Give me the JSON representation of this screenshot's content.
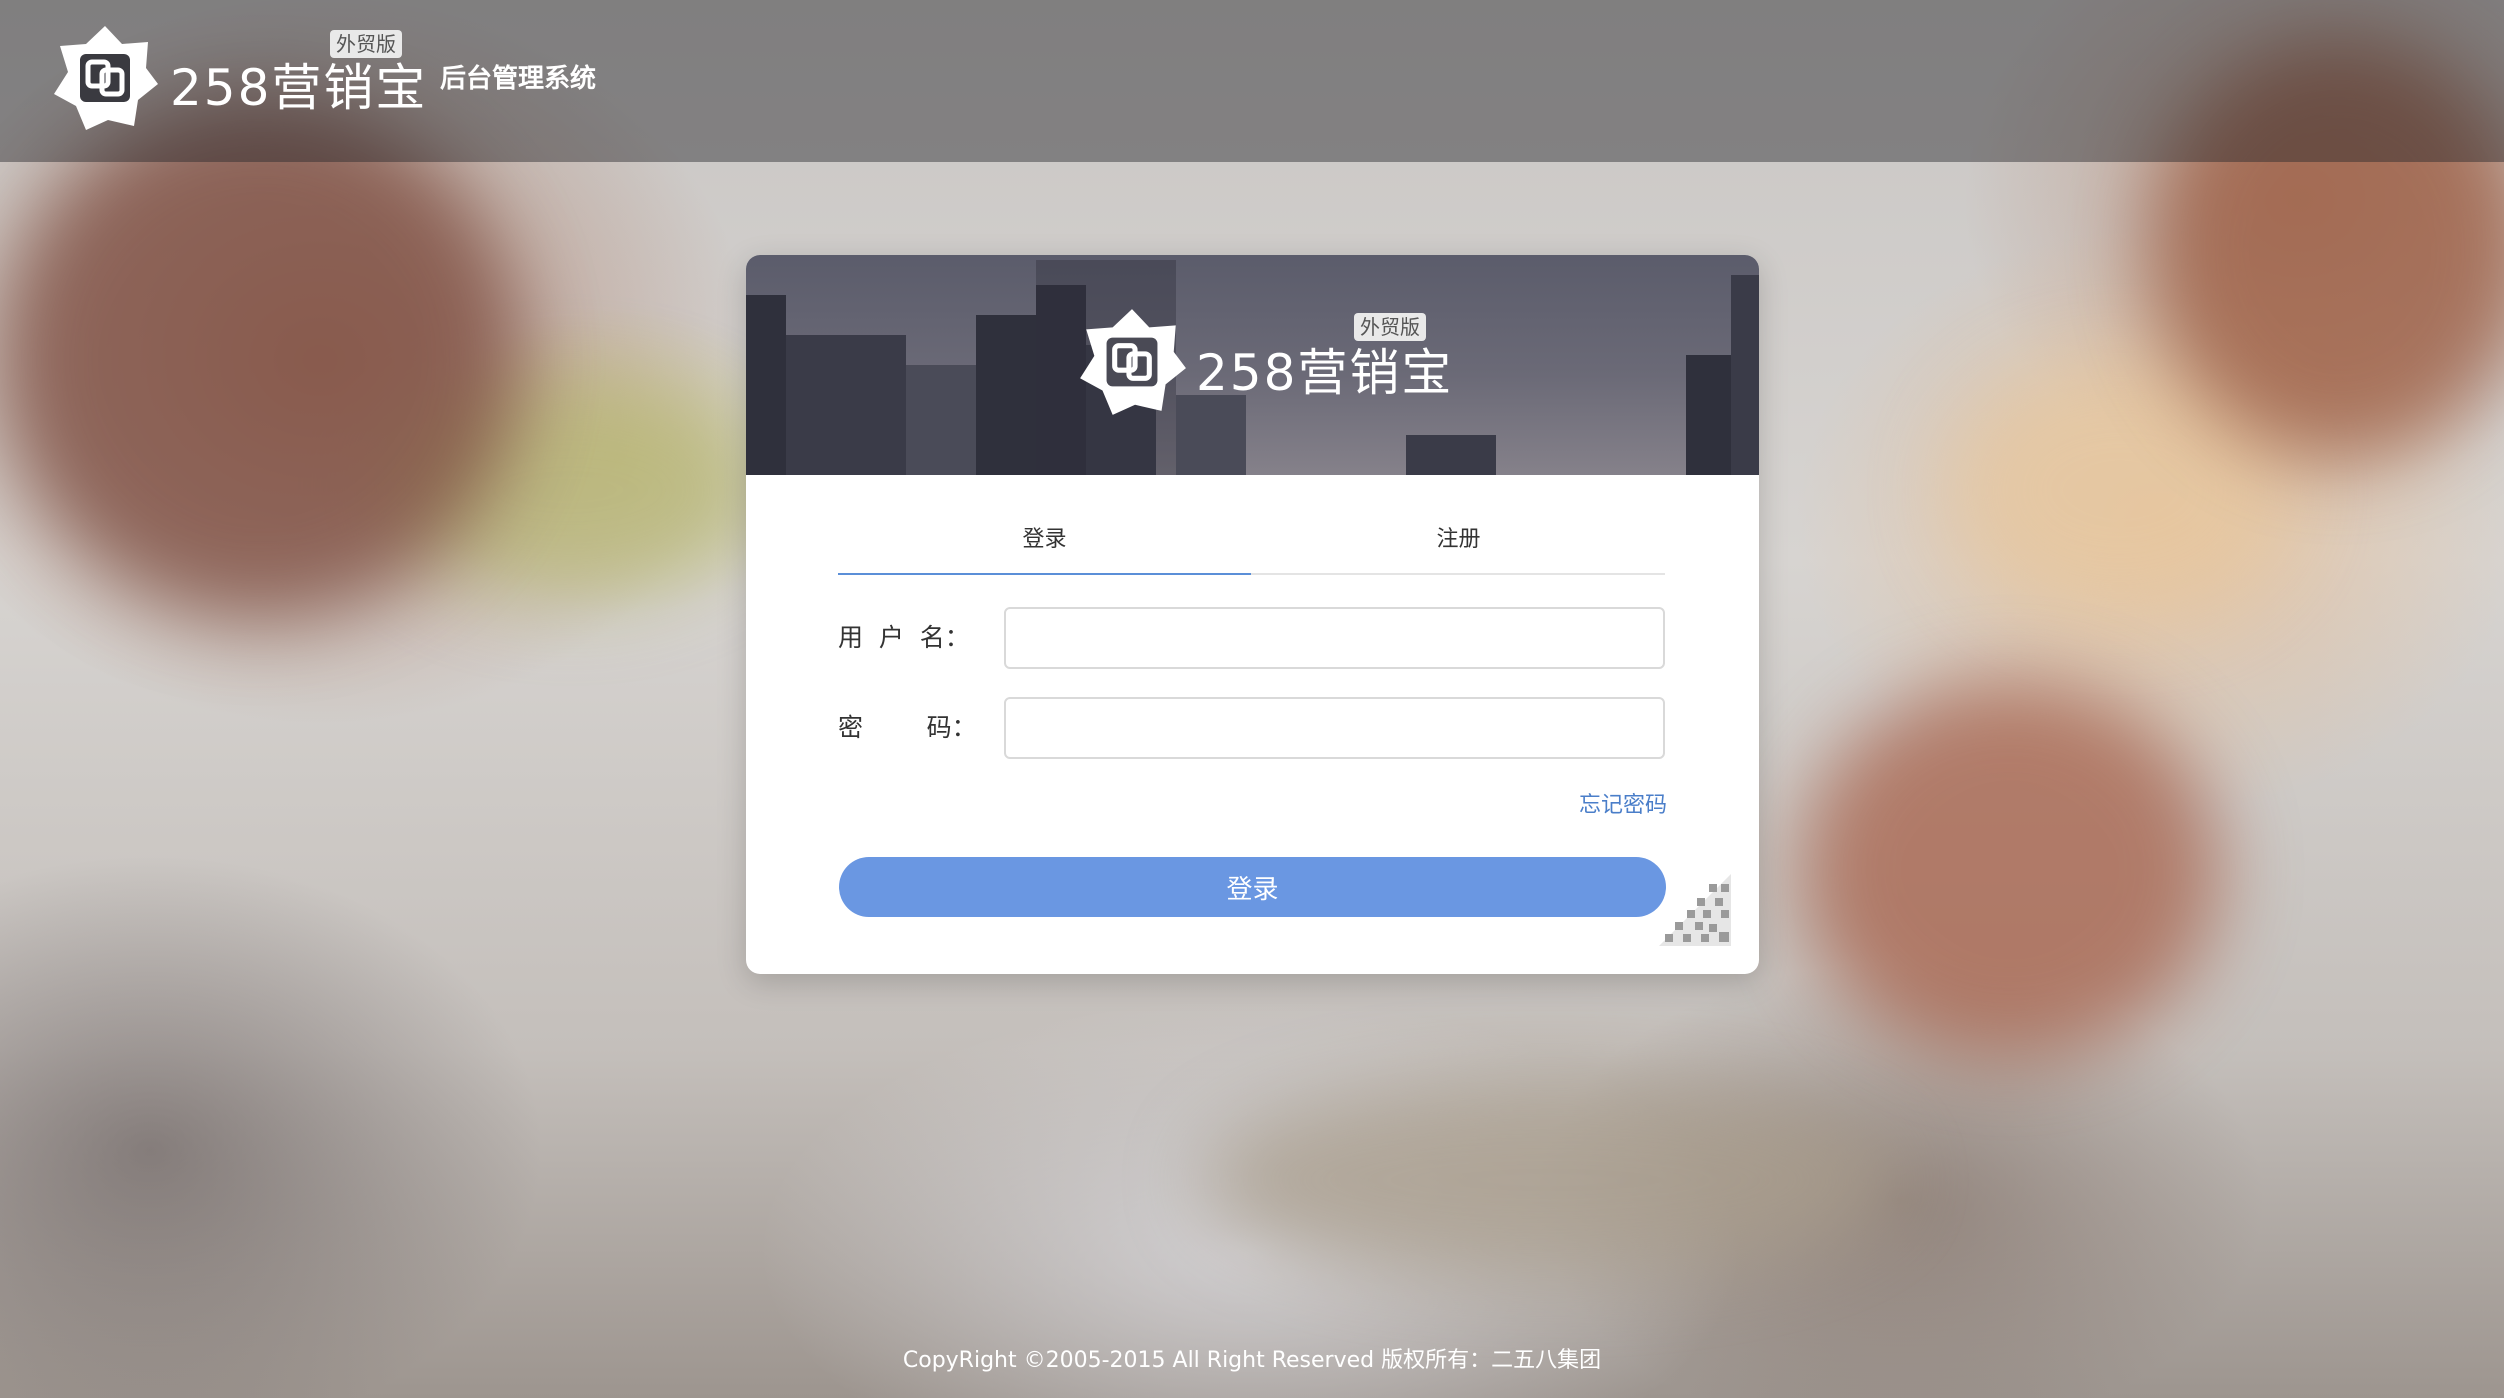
{
  "header": {
    "brand_name": "258营销宝",
    "brand_badge": "外贸版",
    "system_title": "后台管理系统"
  },
  "login_card": {
    "banner": {
      "brand_name": "258营销宝",
      "brand_badge": "外贸版"
    },
    "tabs": [
      {
        "label": "登录",
        "active": true
      },
      {
        "label": "注册",
        "active": false
      }
    ],
    "fields": {
      "username": {
        "label": "用  户  名：",
        "value": "",
        "placeholder": ""
      },
      "password": {
        "label": "密        码：",
        "value": "",
        "placeholder": ""
      }
    },
    "forgot_password_label": "忘记密码",
    "submit_label": "登录"
  },
  "footer": {
    "copyright": "CopyRight ©2005-2015 All Right Reserved 版权所有：二五八集团"
  },
  "colors": {
    "accent": "#6a97e2",
    "link": "#4a7ec9",
    "tab_active_underline": "#5b8fd8"
  },
  "icons": {
    "brand_logo": "258-logo-icon",
    "qr_toggle": "qr-code-corner-icon"
  }
}
